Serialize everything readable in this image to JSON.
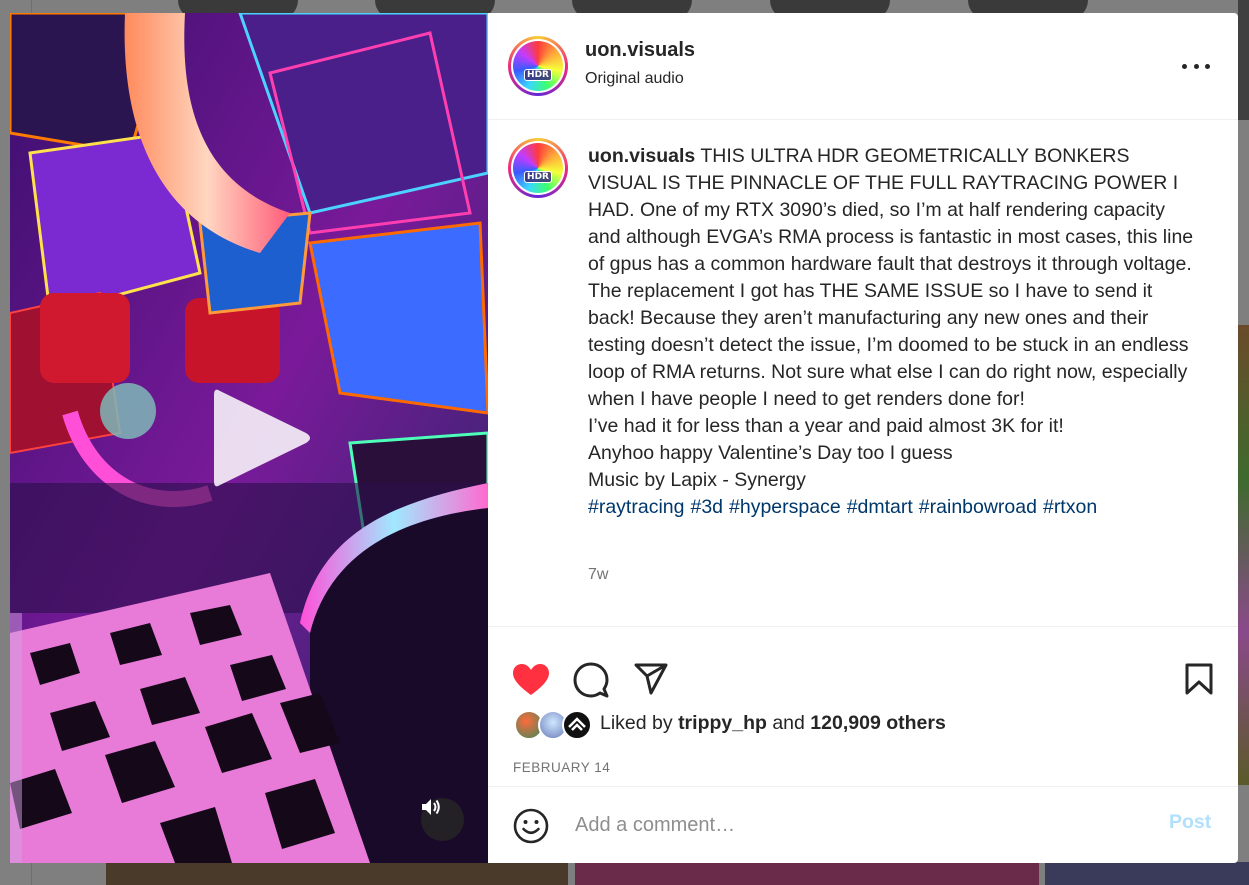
{
  "post": {
    "username": "uon.visuals",
    "audio": "Original audio",
    "avatar_badge": "HDR",
    "caption_lines": [
      "THIS ULTRA HDR GEOMETRICALLY BONKERS VISUAL IS THE PINNACLE OF THE FULL RAYTRACING POWER I HAD. One of my RTX 3090’s died, so I’m at half rendering capacity and although EVGA’s RMA process is fantastic in most cases, this line of gpus has a common hardware fault that destroys it through voltage. The replacement I got has THE SAME ISSUE so I have to send it back! Because they aren’t manufacturing any new ones and their testing doesn’t detect the issue, I’m doomed to be stuck in an endless loop of RMA returns. Not sure what else I can do right now, especially when I have people I need to get renders done for!",
      "I’ve had it for less than a year and paid almost 3K for it!",
      "Anyhoo happy Valentine’s Day too I guess",
      "Music by Lapix - Synergy"
    ],
    "hashtags": [
      "#raytracing",
      "#3d",
      "#hyperspace",
      "#dmtart",
      "#rainbowroad",
      "#rtxon"
    ],
    "time_ago": "7w"
  },
  "likes": {
    "prefix": "Liked by",
    "liker": "trippy_hp",
    "joiner": "and",
    "others": "120,909 others"
  },
  "date": "FEBRUARY 14",
  "comment": {
    "placeholder": "Add a comment…",
    "post_label": "Post"
  },
  "colors": {
    "like_red": "#ff3040",
    "link_blue": "#00376b",
    "post_disabled": "#b2dffc",
    "muted": "#737373"
  },
  "icons": [
    "heart-icon",
    "comment-icon",
    "share-icon",
    "bookmark-icon",
    "emoji-icon",
    "play-icon",
    "speaker-icon",
    "more-icon"
  ]
}
